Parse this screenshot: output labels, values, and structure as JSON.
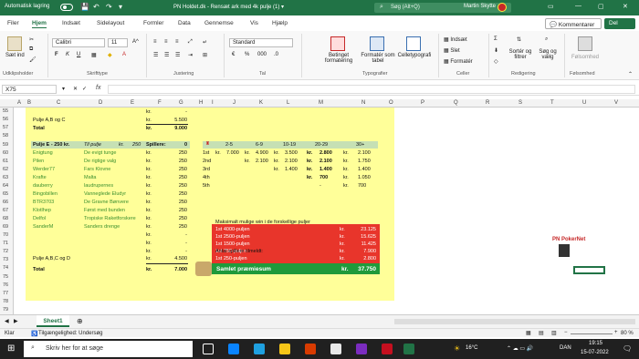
{
  "titlebar": {
    "autosave_label": "Automatisk lagring",
    "autosave_state": "Fra",
    "doc_title": "PN Holdet.dk - Rensæt ark med 4k pulje (1) ▾",
    "search_placeholder": "Søg (Alt+Q)",
    "user_name": "Martin Skytte",
    "colors": {
      "excel_green": "#217346"
    }
  },
  "ribbon_tabs": [
    "Filer",
    "Hjem",
    "Indsæt",
    "Sidelayout",
    "Formler",
    "Data",
    "Gennemse",
    "Vis",
    "Hjælp"
  ],
  "ribbon_actions": {
    "comments": "Kommentarer",
    "share": "Del"
  },
  "ribbon": {
    "clipboard": {
      "paste": "Sæt ind",
      "label": "Udklipsholder"
    },
    "font": {
      "name": "Calibri",
      "size": "11",
      "label": "Skrifttype"
    },
    "alignment": {
      "label": "Justering"
    },
    "number": {
      "format": "Standard",
      "label": "Tal"
    },
    "styles": {
      "conditional": "Betinget formatering",
      "table": "Formatér som tabel",
      "cellstyles": "Celletypografi",
      "label": "Typografier"
    },
    "cells": {
      "insert": "Indsæt",
      "delete": "Slet",
      "format": "Formatér",
      "label": "Celler"
    },
    "editing": {
      "sort": "Sortér og filtrer",
      "find": "Søg og vælg",
      "label": "Redigering"
    },
    "sensitivity": {
      "label": "Følsomhed",
      "button": "Følsomhed"
    }
  },
  "formula_bar": {
    "namebox": "X75",
    "fx": "fx",
    "value": ""
  },
  "columns": [
    "A",
    "B",
    "C",
    "D",
    "E",
    "F",
    "G",
    "H",
    "I",
    "J",
    "K",
    "L",
    "M",
    "N",
    "O",
    "P",
    "Q",
    "R",
    "S",
    "T",
    "U",
    "V"
  ],
  "rows": [
    "55",
    "56",
    "57",
    "58",
    "59",
    "60",
    "61",
    "62",
    "63",
    "64",
    "65",
    "66",
    "67",
    "68",
    "69",
    "70",
    "71",
    "72",
    "73",
    "74",
    "75",
    "76",
    "77",
    "78",
    "79",
    "80",
    "81",
    "82"
  ],
  "left_table": {
    "top_rows": [
      {
        "col_a": "",
        "unit": "kr.",
        "value": "-"
      },
      {
        "col_a": "Pulje A,B og C",
        "unit": "kr.",
        "value": "5.500"
      },
      {
        "col_a": "Total",
        "unit": "kr.",
        "value": "9.000"
      }
    ],
    "header": {
      "name": "Pulje E - 250 kr.",
      "team": "Til pulje",
      "kr": "kr.",
      "amount": "250",
      "players": "Spillere:",
      "count": "0"
    },
    "players": [
      {
        "name": "Enigtung",
        "team": "De evigt tunge",
        "unit": "kr.",
        "value": "250"
      },
      {
        "name": "Pilen",
        "team": "De rigtige valg",
        "unit": "kr.",
        "value": "250"
      },
      {
        "name": "Werder77",
        "team": "Fars Klovne",
        "unit": "kr.",
        "value": "250"
      },
      {
        "name": "Krafte",
        "team": "Malta",
        "unit": "kr.",
        "value": "250"
      },
      {
        "name": "dauberry",
        "team": "laudrupernes",
        "unit": "kr.",
        "value": "250"
      },
      {
        "name": "Bingobillen",
        "team": "Vanneglede Eludyr",
        "unit": "kr.",
        "value": "250"
      },
      {
        "name": "BTR3703",
        "team": "De Gravne Bønvere",
        "unit": "kr.",
        "value": "250"
      },
      {
        "name": "Klotlhep",
        "team": "Først med bunden",
        "unit": "kr.",
        "value": "250"
      },
      {
        "name": "Delfol",
        "team": "Tropiske Raketforskere",
        "unit": "kr.",
        "value": "250"
      },
      {
        "name": "SanderM",
        "team": "Sanders drenge",
        "unit": "kr.",
        "value": "250"
      },
      {
        "name": "",
        "team": "",
        "unit": "kr.",
        "value": "-"
      },
      {
        "name": "",
        "team": "",
        "unit": "kr.",
        "value": "-"
      },
      {
        "name": "",
        "team": "",
        "unit": "kr.",
        "value": "-"
      }
    ],
    "bottom_rows": [
      {
        "col_a": "Pulje A,B,C og D",
        "unit": "kr.",
        "value": "4.500"
      },
      {
        "col_a": "Total",
        "unit": "kr.",
        "value": "7.000"
      }
    ]
  },
  "payout_table": {
    "headers": [
      "2-5",
      "6-9",
      "10-19",
      "20-29",
      "30+"
    ],
    "rows": [
      {
        "place": "1st",
        "v": [
          "kr.",
          "7.000",
          "kr.",
          "4.900",
          "kr.",
          "3.500",
          "kr.",
          "2.800",
          "kr.",
          "2.100"
        ]
      },
      {
        "place": "2nd",
        "v": [
          "",
          "",
          "kr.",
          "2.100",
          "kr.",
          "2.100",
          "kr.",
          "2.100",
          "kr.",
          "1.750"
        ]
      },
      {
        "place": "3rd",
        "v": [
          "",
          "",
          "",
          "",
          "kr.",
          "1.400",
          "kr.",
          "1.400",
          "kr.",
          "1.400"
        ]
      },
      {
        "place": "4th",
        "v": [
          "",
          "",
          "",
          "",
          "",
          "",
          "kr.",
          "700",
          "kr.",
          "1.050"
        ]
      },
      {
        "place": "5th",
        "v": [
          "",
          "",
          "",
          "",
          "",
          "",
          "",
          "-",
          "kr.",
          "700"
        ]
      }
    ]
  },
  "max_win": {
    "title": "Maksimalt mulige win i de forskellige puljer",
    "rows": [
      {
        "label": "1st 4000-puljen",
        "unit": "kr.",
        "value": "23.125"
      },
      {
        "label": "1st 2500-puljen",
        "unit": "kr.",
        "value": "15.625"
      },
      {
        "label": "1st 1500-puljen",
        "unit": "kr.",
        "value": "11.425"
      },
      {
        "label": "1st 750-puljen",
        "unit": "kr.",
        "value": "7.900"
      },
      {
        "label": "1st 250-puljen",
        "unit": "kr.",
        "value": "2.800"
      }
    ],
    "players_signed": "Antal spillere tilmeldt:",
    "total_label": "Samlet præmiesum",
    "total_unit": "kr.",
    "total_value": "37.750"
  },
  "sheet": {
    "tab": "Sheet1"
  },
  "status": {
    "ready": "Klar",
    "accessibility": "Tilgængelighed: Undersøg",
    "zoom": "80 %"
  },
  "taskbar": {
    "search": "Skriv her for at søge",
    "temp": "16°C",
    "lang": "DAN",
    "time": "19:15",
    "date": "15-07-2022"
  }
}
